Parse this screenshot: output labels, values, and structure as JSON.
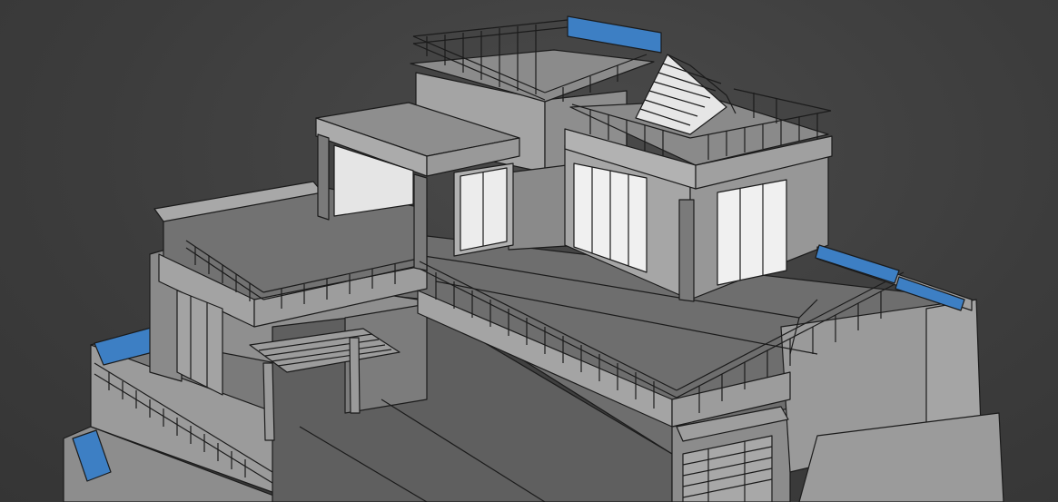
{
  "scene": {
    "background_color": "#3f3f3f",
    "selection_color": "#3d7fc4",
    "wall_light": "#b9b9b9",
    "wall_mid": "#9a9a9a",
    "wall_dark": "#7d7d7d",
    "floor_color": "#6d6d6d",
    "glass_color": "#e9e9e9"
  }
}
